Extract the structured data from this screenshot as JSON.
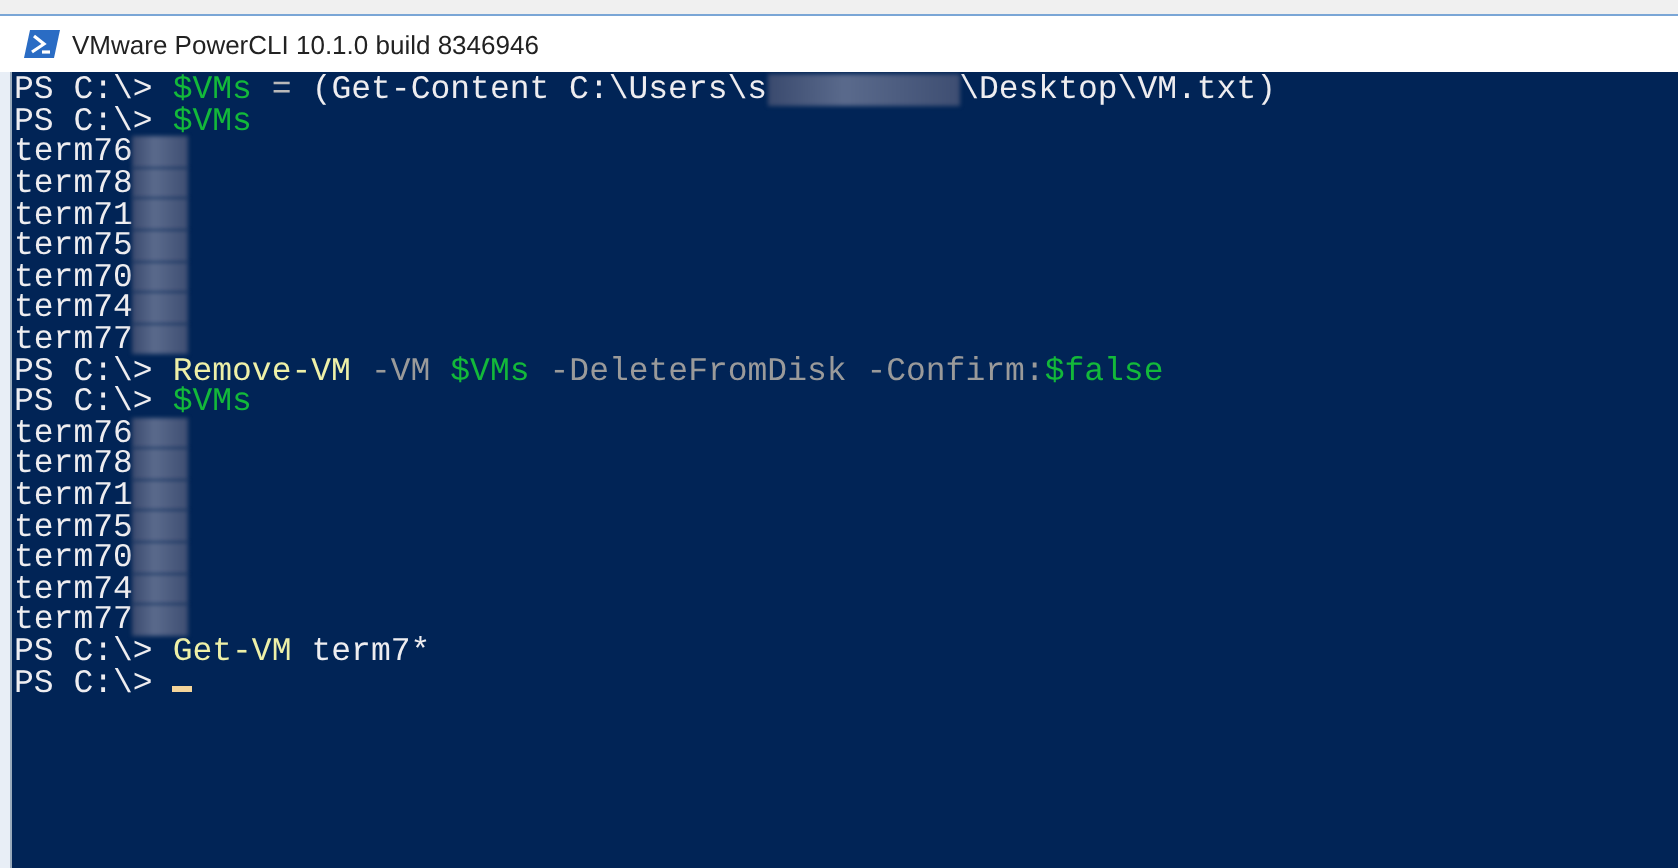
{
  "window": {
    "title": "VMware PowerCLI 10.1.0 build 8346946"
  },
  "console": {
    "lines": [
      [
        {
          "kind": "prompt",
          "text": "PS C:\\>"
        },
        {
          "kind": "variable",
          "text": "$VMs"
        },
        {
          "kind": "operator",
          "text": "="
        },
        {
          "kind": "text",
          "text": "(Get-Content C:\\Users\\s"
        },
        {
          "kind": "redacted_long"
        },
        {
          "kind": "text",
          "text": "\\Desktop\\VM.txt)"
        }
      ],
      [
        {
          "kind": "prompt",
          "text": "PS C:\\>"
        },
        {
          "kind": "variable",
          "text": "$VMs"
        }
      ],
      [
        {
          "kind": "output",
          "text": "term76"
        },
        {
          "kind": "redacted"
        }
      ],
      [
        {
          "kind": "output",
          "text": "term78"
        },
        {
          "kind": "redacted"
        }
      ],
      [
        {
          "kind": "output",
          "text": "term71"
        },
        {
          "kind": "redacted"
        }
      ],
      [
        {
          "kind": "output",
          "text": "term75"
        },
        {
          "kind": "redacted"
        }
      ],
      [
        {
          "kind": "output",
          "text": "term70"
        },
        {
          "kind": "redacted"
        }
      ],
      [
        {
          "kind": "output",
          "text": "term74"
        },
        {
          "kind": "redacted"
        }
      ],
      [
        {
          "kind": "output",
          "text": "term77"
        },
        {
          "kind": "redacted"
        }
      ],
      [
        {
          "kind": "prompt",
          "text": "PS C:\\>"
        },
        {
          "kind": "command",
          "text": "Remove-VM"
        },
        {
          "kind": "parameter",
          "text": "-VM"
        },
        {
          "kind": "variable",
          "text": "$VMs"
        },
        {
          "kind": "parameter",
          "text": "-DeleteFromDisk -Confirm:"
        },
        {
          "kind": "variable_tight",
          "text": "$false"
        }
      ],
      [
        {
          "kind": "prompt",
          "text": "PS C:\\>"
        },
        {
          "kind": "variable",
          "text": "$VMs"
        }
      ],
      [
        {
          "kind": "output",
          "text": "term76"
        },
        {
          "kind": "redacted"
        }
      ],
      [
        {
          "kind": "output",
          "text": "term78"
        },
        {
          "kind": "redacted"
        }
      ],
      [
        {
          "kind": "output",
          "text": "term71"
        },
        {
          "kind": "redacted"
        }
      ],
      [
        {
          "kind": "output",
          "text": "term75"
        },
        {
          "kind": "redacted"
        }
      ],
      [
        {
          "kind": "output",
          "text": "term70"
        },
        {
          "kind": "redacted"
        }
      ],
      [
        {
          "kind": "output",
          "text": "term74"
        },
        {
          "kind": "redacted"
        }
      ],
      [
        {
          "kind": "output",
          "text": "term77"
        },
        {
          "kind": "redacted"
        }
      ],
      [
        {
          "kind": "prompt",
          "text": "PS C:\\>"
        },
        {
          "kind": "command",
          "text": "Get-VM"
        },
        {
          "kind": "text",
          "text": "term7*"
        }
      ],
      [
        {
          "kind": "prompt",
          "text": "PS C:\\>"
        },
        {
          "kind": "cursor"
        }
      ]
    ]
  }
}
